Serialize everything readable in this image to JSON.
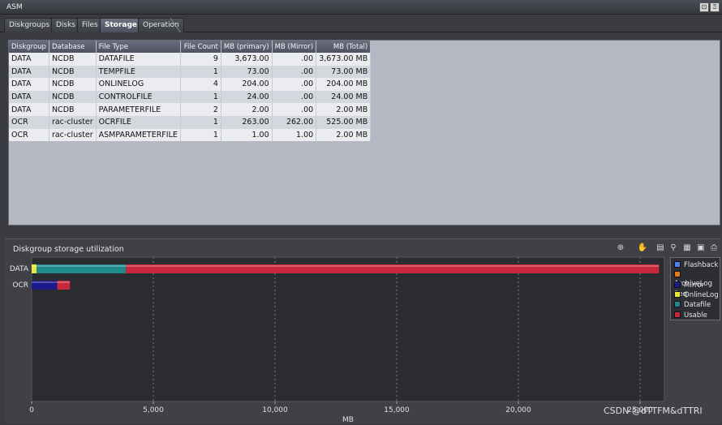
{
  "window": {
    "title": "ASM",
    "buttons": [
      "⊡",
      "⍰"
    ]
  },
  "tabs": [
    {
      "label": "Diskgroups",
      "active": false
    },
    {
      "label": "Disks",
      "active": false
    },
    {
      "label": "Files",
      "active": false
    },
    {
      "label": "Storage",
      "active": true
    },
    {
      "label": "Operation",
      "active": false
    }
  ],
  "table": {
    "columns": [
      "Diskgroup",
      "Database",
      "File Type",
      "File Count",
      "MB  (primary)",
      "MB (Mirror)",
      "MB (Total)"
    ],
    "rows": [
      [
        "DATA",
        "NCDB",
        "DATAFILE",
        "9",
        "3,673.00",
        ".00",
        "3,673.00 MB"
      ],
      [
        "DATA",
        "NCDB",
        "TEMPFILE",
        "1",
        "73.00",
        ".00",
        "73.00 MB"
      ],
      [
        "DATA",
        "NCDB",
        "ONLINELOG",
        "4",
        "204.00",
        ".00",
        "204.00 MB"
      ],
      [
        "DATA",
        "NCDB",
        "CONTROLFILE",
        "1",
        "24.00",
        ".00",
        "24.00 MB"
      ],
      [
        "DATA",
        "NCDB",
        "PARAMETERFILE",
        "2",
        "2.00",
        ".00",
        "2.00 MB"
      ],
      [
        "OCR",
        "rac-cluster",
        "OCRFILE",
        "1",
        "263.00",
        "262.00",
        "525.00 MB"
      ],
      [
        "OCR",
        "rac-cluster",
        "ASMPARAMETERFILE",
        "1",
        "1.00",
        "1.00",
        "2.00 MB"
      ]
    ]
  },
  "chart_panel": {
    "title": "Diskgroup storage utilization",
    "tool_icons": [
      "zoom-icon",
      "hand-icon",
      "bar-chart-icon",
      "filter-icon",
      "table-icon",
      "save-icon",
      "print-icon"
    ]
  },
  "chart_data": {
    "type": "bar",
    "orientation": "horizontal",
    "stacked": true,
    "categories": [
      "DATA",
      "OCR"
    ],
    "series": [
      {
        "name": "Flashback",
        "color": "#4f7fe8",
        "values": [
          0,
          0
        ]
      },
      {
        "name": "ArchiveLog",
        "color": "#e07a1a",
        "values": [
          0,
          0
        ]
      },
      {
        "name": "Mirror Req.",
        "color": "#1a1a8c",
        "values": [
          0,
          1050
        ]
      },
      {
        "name": "OnlineLog",
        "color": "#e8e83a",
        "values": [
          204,
          0
        ]
      },
      {
        "name": "Datafile",
        "color": "#1e8a8a",
        "values": [
          3673,
          0
        ]
      },
      {
        "name": "Usable",
        "color": "#c8283c",
        "values": [
          21900,
          520
        ]
      }
    ],
    "xlabel": "MB",
    "ylabel": "",
    "xlim": [
      0,
      26000
    ],
    "xticks": [
      "0",
      "5,000",
      "10,000",
      "15,000",
      "20,000",
      "25,000"
    ],
    "xtick_values": [
      0,
      5000,
      10000,
      15000,
      20000,
      25000
    ],
    "grid": true,
    "legend": "right"
  },
  "watermark": "CSDN @dTTFM&dTTRI"
}
